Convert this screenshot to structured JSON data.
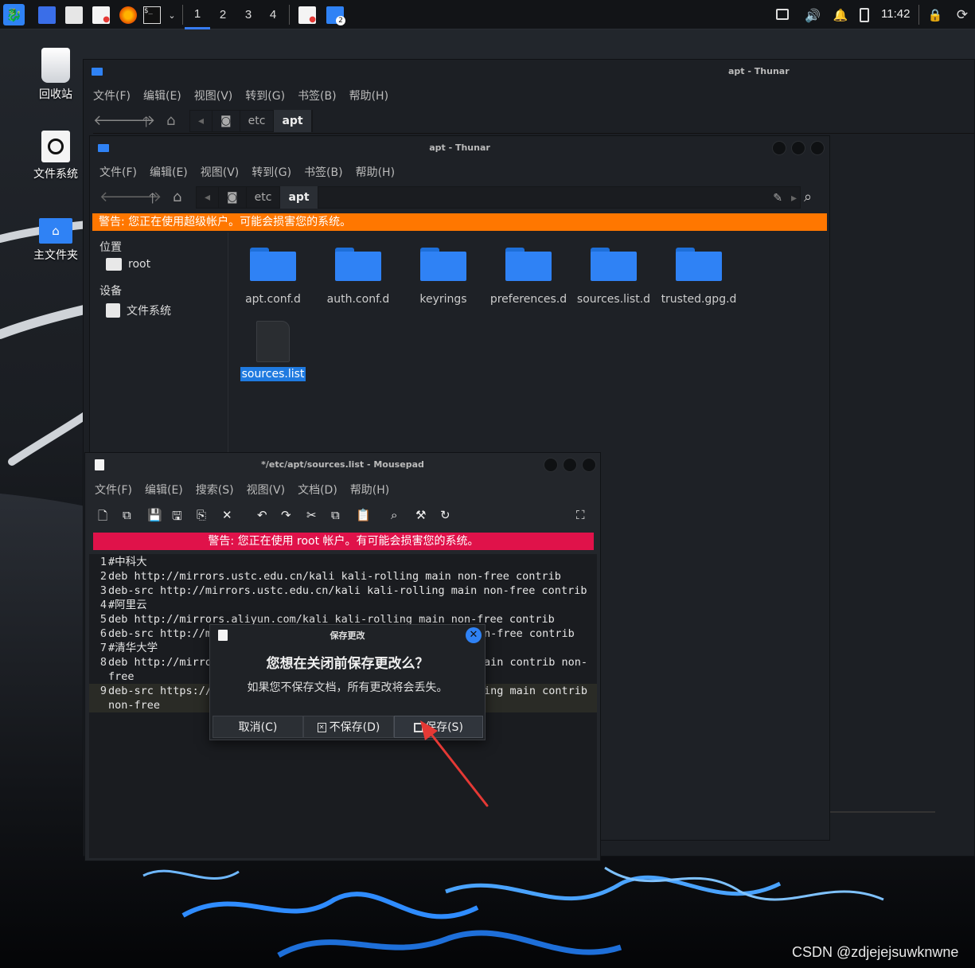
{
  "taskbar": {
    "workspaces": [
      "1",
      "2",
      "3",
      "4"
    ],
    "active_workspace": "1",
    "clock": "11:42",
    "badge": "2"
  },
  "desktop": {
    "icons": [
      {
        "label": "回收站"
      },
      {
        "label": "文件系统"
      },
      {
        "label": "主文件夹"
      }
    ],
    "watermark": "CSDN @zdjejejsuwknwne"
  },
  "thunar_back": {
    "title": "apt - Thunar",
    "menu": [
      "文件(F)",
      "编辑(E)",
      "视图(V)",
      "转到(G)",
      "书签(B)",
      "帮助(H)"
    ],
    "path": [
      "etc",
      "apt"
    ]
  },
  "thunar": {
    "title": "apt - Thunar",
    "menu": [
      "文件(F)",
      "编辑(E)",
      "视图(V)",
      "转到(G)",
      "书签(B)",
      "帮助(H)"
    ],
    "path": [
      "etc",
      "apt"
    ],
    "warning": "警告: 您正在使用超级帐户。可能会损害您的系统。",
    "sidebar": {
      "places_header": "位置",
      "root": "root",
      "devices_header": "设备",
      "filesystem": "文件系统"
    },
    "files": [
      {
        "name": "apt.conf.d",
        "type": "folder"
      },
      {
        "name": "auth.conf.d",
        "type": "folder"
      },
      {
        "name": "keyrings",
        "type": "folder"
      },
      {
        "name": "preferences.d",
        "type": "folder"
      },
      {
        "name": "sources.list.d",
        "type": "folder"
      },
      {
        "name": "trusted.gpg.d",
        "type": "folder"
      },
      {
        "name": "sources.list",
        "type": "file",
        "selected": true
      }
    ]
  },
  "mousepad": {
    "title": "*/etc/apt/sources.list - Mousepad",
    "menu": [
      "文件(F)",
      "编辑(E)",
      "搜索(S)",
      "视图(V)",
      "文档(D)",
      "帮助(H)"
    ],
    "warning": "警告: 您正在使用 root 帐户。有可能会损害您的系统。",
    "lines": [
      {
        "n": "1",
        "text": "#中科大"
      },
      {
        "n": "2",
        "text": "deb http://mirrors.ustc.edu.cn/kali kali-rolling main non-free contrib"
      },
      {
        "n": "3",
        "text": "deb-src http://mirrors.ustc.edu.cn/kali kali-rolling main non-free contrib"
      },
      {
        "n": "4",
        "text": "#阿里云"
      },
      {
        "n": "5",
        "text": "deb http://mirrors.aliyun.com/kali kali-rolling main non-free contrib"
      },
      {
        "n": "6",
        "text": "deb-src http://m"
      },
      {
        "n": "7",
        "text": "#清华大学"
      },
      {
        "n": "8",
        "text": "deb http://mirro"
      },
      {
        "n": "",
        "text": "free"
      },
      {
        "n": "9",
        "text": "deb-src https://"
      },
      {
        "n": "",
        "text": "non-free"
      }
    ],
    "line6_tail": "n-free contrib",
    "line8_tail": "ain contrib non-",
    "line9_tail": "ing main contrib"
  },
  "dialog": {
    "title": "保存更改",
    "heading": "您想在关闭前保存更改么？",
    "message": "如果您不保存文档，所有更改将会丢失。",
    "cancel": "取消(C)",
    "dont_save": "不保存(D)",
    "save": "保存(S)"
  },
  "colors": {
    "accent": "#367bf0",
    "folder": "#2f82f5",
    "thunar_warning": "#ff7700",
    "mousepad_warning": "#e0124a",
    "arrow": "#e53935"
  }
}
